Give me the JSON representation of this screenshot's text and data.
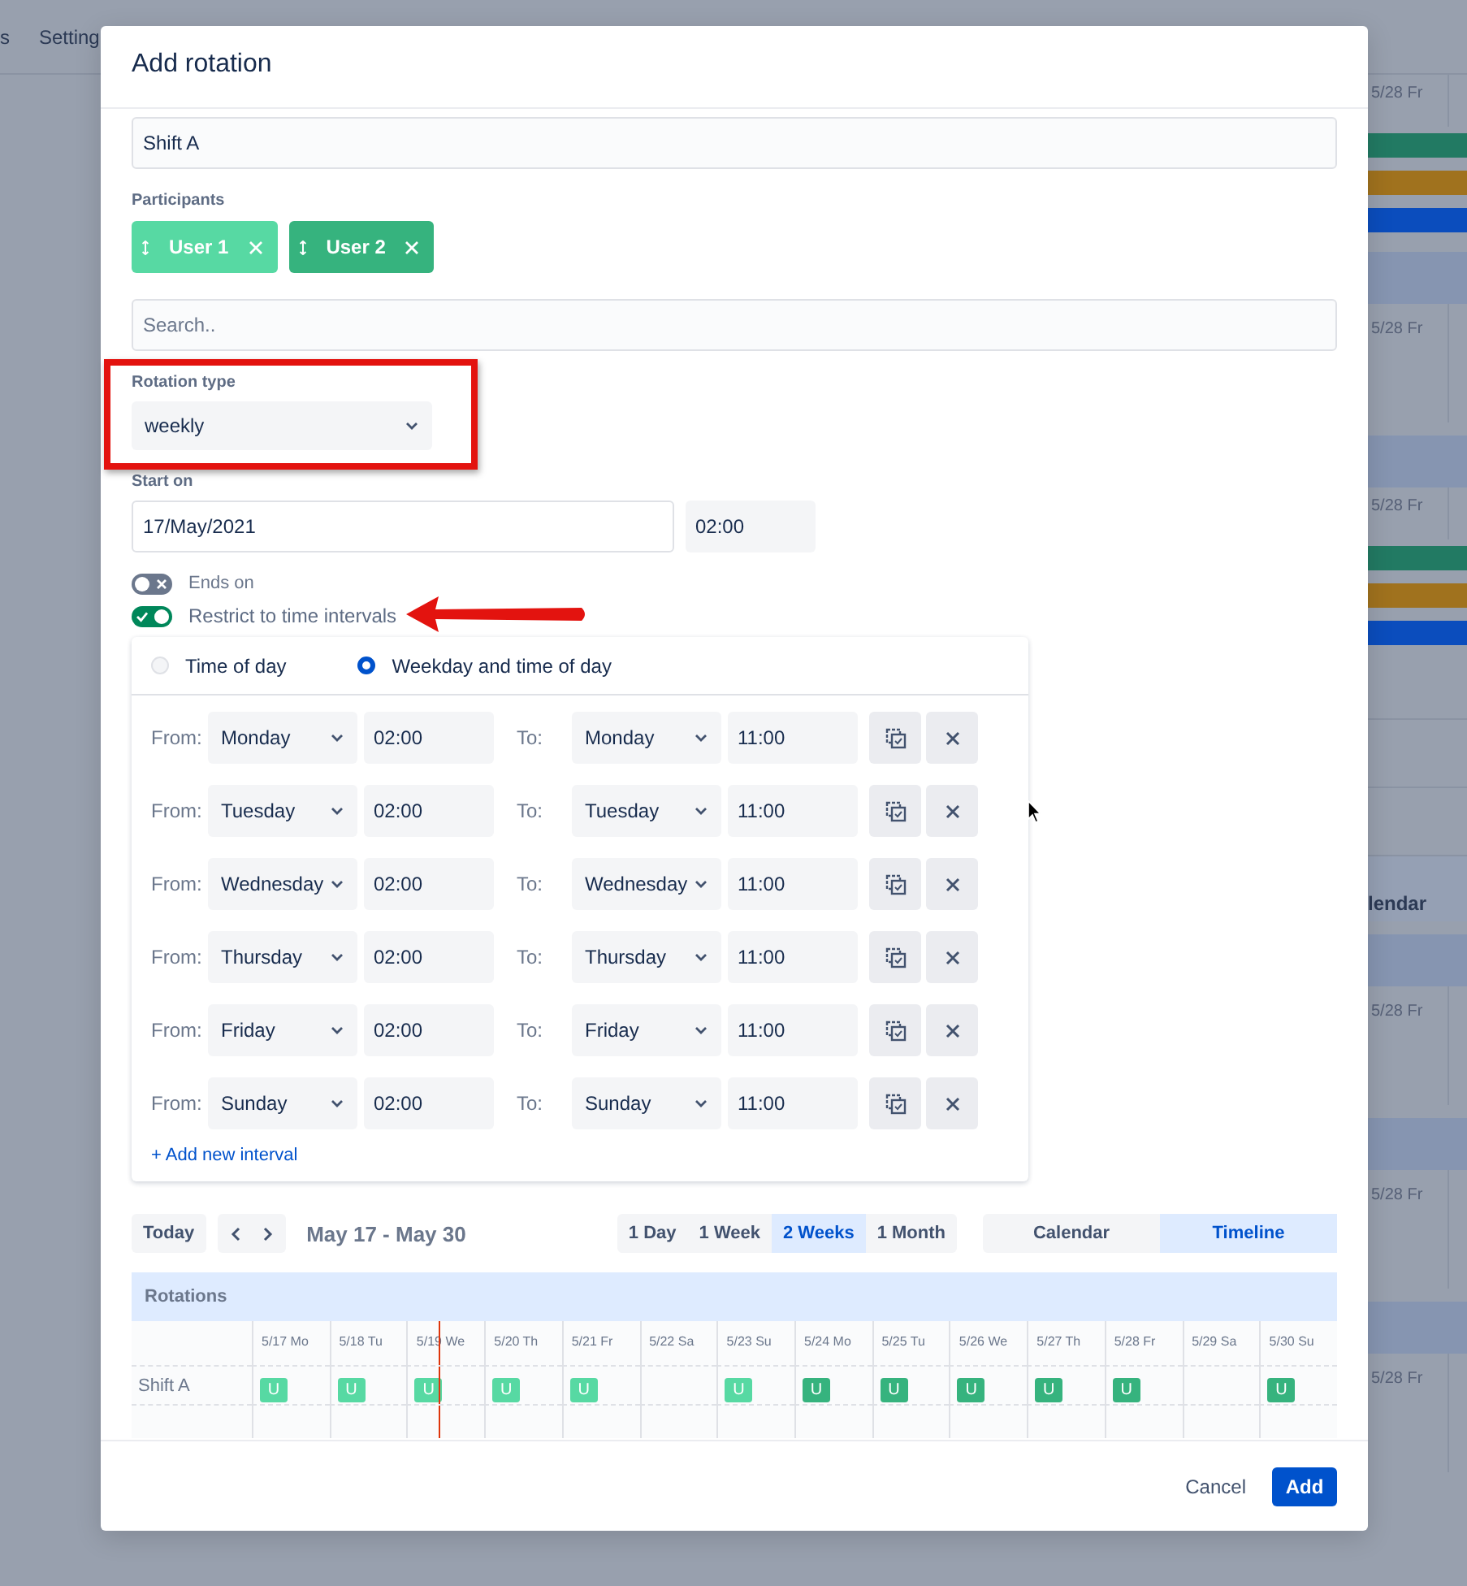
{
  "background": {
    "nav": [
      "s",
      "Setting"
    ],
    "strip": [
      {
        "kind": "date",
        "text": "5/28 Fr"
      },
      {
        "kind": "bar",
        "color": "#227a63"
      },
      {
        "kind": "bar",
        "color": "#a0721e"
      },
      {
        "kind": "bar",
        "color": "#0b4dbd"
      },
      {
        "kind": "band"
      },
      {
        "kind": "cell",
        "text": "5/28 Fr"
      },
      {
        "kind": "band"
      },
      {
        "kind": "date",
        "text": "5/28 Fr"
      },
      {
        "kind": "bar",
        "color": "#227a63"
      },
      {
        "kind": "bar",
        "color": "#a0721e"
      },
      {
        "kind": "bar",
        "color": "#0b4dbd"
      },
      {
        "kind": "row"
      },
      {
        "kind": "row"
      },
      {
        "kind": "row"
      },
      {
        "kind": "label",
        "text": "lendar"
      },
      {
        "kind": "band"
      },
      {
        "kind": "cell",
        "text": "5/28 Fr"
      },
      {
        "kind": "band"
      },
      {
        "kind": "cell",
        "text": "5/28 Fr"
      },
      {
        "kind": "band"
      },
      {
        "kind": "cell",
        "text": "5/28 Fr"
      }
    ]
  },
  "dialog": {
    "title": "Add rotation",
    "name_field": {
      "value": "Shift A"
    },
    "participants": {
      "label": "Participants",
      "chips": [
        {
          "label": "User 1",
          "color": "#57d9a3"
        },
        {
          "label": "User 2",
          "color": "#36b37e"
        }
      ]
    },
    "search": {
      "placeholder": "Search.."
    },
    "rotation_type": {
      "label": "Rotation type",
      "value": "weekly"
    },
    "start_on": {
      "label": "Start on",
      "date": "17/May/2021",
      "time": "02:00"
    },
    "toggles": [
      {
        "label": "Ends on",
        "on": false
      },
      {
        "label": "Restrict to time intervals",
        "on": true
      }
    ],
    "interval_modes": [
      {
        "label": "Time of day",
        "selected": false
      },
      {
        "label": "Weekday and time of day",
        "selected": true
      }
    ],
    "intervals": [
      {
        "from_label": "From:",
        "from_day": "Monday",
        "from_time": "02:00",
        "to_label": "To:",
        "to_day": "Monday",
        "to_time": "11:00"
      },
      {
        "from_label": "From:",
        "from_day": "Tuesday",
        "from_time": "02:00",
        "to_label": "To:",
        "to_day": "Tuesday",
        "to_time": "11:00"
      },
      {
        "from_label": "From:",
        "from_day": "Wednesday",
        "from_time": "02:00",
        "to_label": "To:",
        "to_day": "Wednesday",
        "to_time": "11:00"
      },
      {
        "from_label": "From:",
        "from_day": "Thursday",
        "from_time": "02:00",
        "to_label": "To:",
        "to_day": "Thursday",
        "to_time": "11:00"
      },
      {
        "from_label": "From:",
        "from_day": "Friday",
        "from_time": "02:00",
        "to_label": "To:",
        "to_day": "Friday",
        "to_time": "11:00"
      },
      {
        "from_label": "From:",
        "from_day": "Sunday",
        "from_time": "02:00",
        "to_label": "To:",
        "to_day": "Sunday",
        "to_time": "11:00"
      }
    ],
    "add_interval": "+ Add new interval",
    "calendar": {
      "today": "Today",
      "range": "May 17 - May 30",
      "spans": [
        {
          "label": "1 Day",
          "selected": false
        },
        {
          "label": "1 Week",
          "selected": false
        },
        {
          "label": "2 Weeks",
          "selected": true
        },
        {
          "label": "1 Month",
          "selected": false
        }
      ],
      "views": [
        {
          "label": "Calendar",
          "selected": false
        },
        {
          "label": "Timeline",
          "selected": true
        }
      ],
      "timeline": {
        "title": "Rotations",
        "days": [
          {
            "label": "5/17 Mo",
            "today": false
          },
          {
            "label": "5/18 Tu",
            "today": false
          },
          {
            "label": "5/19 We",
            "today": true
          },
          {
            "label": "5/20 Th",
            "today": false
          },
          {
            "label": "5/21 Fr",
            "today": false
          },
          {
            "label": "5/22 Sa",
            "today": false
          },
          {
            "label": "5/23 Su",
            "today": false
          },
          {
            "label": "5/24 Mo",
            "today": false
          },
          {
            "label": "5/25 Tu",
            "today": false
          },
          {
            "label": "5/26 We",
            "today": false
          },
          {
            "label": "5/27 Th",
            "today": false
          },
          {
            "label": "5/28 Fr",
            "today": false
          },
          {
            "label": "5/29 Sa",
            "today": false
          },
          {
            "label": "5/30 Su",
            "today": false
          }
        ],
        "rows": [
          {
            "label": "Shift A",
            "cells": [
              {
                "kind": "shift",
                "text": "U",
                "color": "#57d9a3"
              },
              {
                "kind": "shift",
                "text": "U",
                "color": "#57d9a3"
              },
              {
                "kind": "shift",
                "text": "U",
                "color": "#57d9a3"
              },
              {
                "kind": "shift",
                "text": "U",
                "color": "#57d9a3"
              },
              {
                "kind": "shift",
                "text": "U",
                "color": "#57d9a3"
              },
              {
                "kind": "empty"
              },
              {
                "kind": "shift",
                "text": "U",
                "color": "#57d9a3"
              },
              {
                "kind": "shift",
                "text": "U",
                "color": "#36b37e"
              },
              {
                "kind": "shift",
                "text": "U",
                "color": "#36b37e"
              },
              {
                "kind": "shift",
                "text": "U",
                "color": "#36b37e"
              },
              {
                "kind": "shift",
                "text": "U",
                "color": "#36b37e"
              },
              {
                "kind": "shift",
                "text": "U",
                "color": "#36b37e"
              },
              {
                "kind": "empty"
              },
              {
                "kind": "shift",
                "text": "U",
                "color": "#36b37e"
              }
            ]
          }
        ]
      }
    },
    "footer": {
      "cancel": "Cancel",
      "add": "Add"
    }
  },
  "annotations": {
    "highlight_frame": true,
    "arrow": true
  }
}
